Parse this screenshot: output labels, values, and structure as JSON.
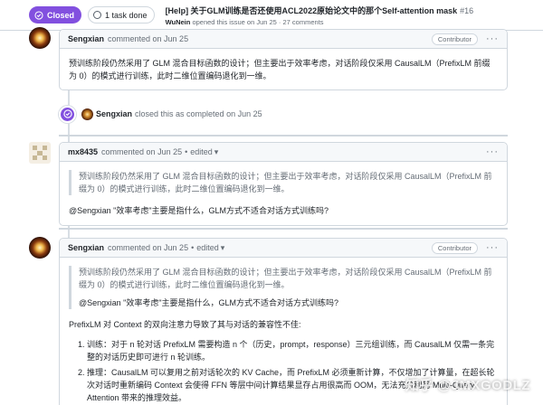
{
  "header": {
    "state_label": "Closed",
    "tasks_label": "1 task done",
    "title": "[Help] 关于GLM训练是否还使用ACL2022原始论文中的那个Self-attention mask",
    "issue_number": "#16",
    "opener": "WuNein",
    "opened_text": "opened this issue on Jun 25 · 27 comments"
  },
  "comments": [
    {
      "author": "Sengxian",
      "meta": "commented on Jun 25",
      "role": "Contributor",
      "body": "预训练阶段仍然采用了 GLM 混合目标函数的设计；但主要出于效率考虑，对话阶段仅采用 CausalLM（PrefixLM 前缀为 0）的模式进行训练，此时二维位置编码退化到一维。"
    },
    {
      "author": "mx8435",
      "meta": "commented on Jun 25",
      "edited": "edited",
      "quote": "预训练阶段仍然采用了 GLM 混合目标函数的设计；但主要出于效率考虑，对话阶段仅采用 CausalLM（PrefixLM 前缀为 0）的模式进行训练，此时二维位置编码退化到一维。",
      "body": "@Sengxian \"效率考虑\"主要是指什么，GLM方式不适合对话方式训练吗?"
    },
    {
      "author": "Sengxian",
      "meta": "commented on Jun 25",
      "edited": "edited",
      "role": "Contributor",
      "quote_lines": [
        "预训练阶段仍然采用了 GLM 混合目标函数的设计；但主要出于效率考虑，对话阶段仅采用 CausalLM（PrefixLM 前缀为 0）的模式进行训练，此时二维位置编码退化到一维。",
        "@Sengxian \"效率考虑\"主要是指什么，GLM方式不适合对话方式训练吗?"
      ],
      "para": "PrefixLM 对 Context 的双向注意力导致了其与对话的兼容性不佳:",
      "steps": [
        "训练：对于 n 轮对话 PrefixLM 需要构造 n 个（历史，prompt，response）三元组训练，而 CausalLM 仅需一条完整的对话历史即可进行 n 轮训练。",
        "推理：CausalLM 可以复用之前对话轮次的 KV Cache，而 PrefixLM 必须重新计算，不仅增加了计算量，在超长轮次对话时重新编码 Context 会使得 FFN 等层中间计算结果显存占用很高而 OOM，无法充分利用 Multi-Query Attention 带来的推理效益。"
      ]
    }
  ],
  "event": {
    "actor": "Sengxian",
    "text": "closed this as completed on Jun 25"
  },
  "watermark": "知乎 @JMXGODLZ",
  "colors": {
    "closed_purple": "#8250df",
    "border": "#d0d7de",
    "muted": "#656d76"
  }
}
